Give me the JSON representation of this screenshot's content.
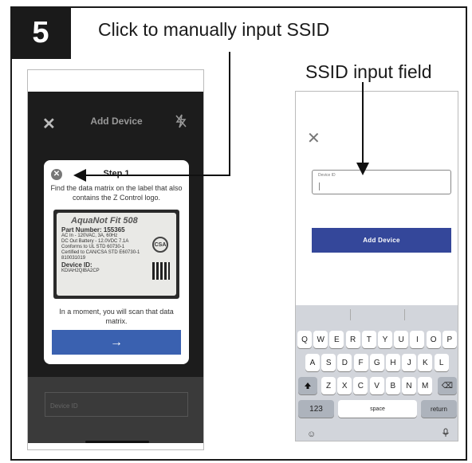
{
  "step_number": "5",
  "captions": {
    "manual_input": "Click to manually input SSID",
    "ssid_field": "SSID input field"
  },
  "left_screen": {
    "header_title": "Add Device",
    "dialog": {
      "title": "Step 1",
      "instruction": "Find the data matrix on the label that also contains the Z Control logo.",
      "label_photo": {
        "brand": "AquaNot Fit 508",
        "part_number": "Part Number: 155365",
        "specs": [
          "AC In - 120VAC, 3A, 60Hz",
          "DC Out Battery - 12.0VDC 7.1A",
          "Conforms to UL STD 60730-1",
          "Certified to CAN/CSA STD E60730-1",
          "810031019"
        ],
        "device_id_label": "Device ID:",
        "device_id_value": "KDIAH2QIBA2CP"
      },
      "note": "In a moment, you will scan that data matrix.",
      "continue_arrow": "→"
    },
    "device_id_placeholder": "Device ID"
  },
  "right_screen": {
    "field_label": "Device ID",
    "add_button": "Add Device",
    "keyboard": {
      "row1": [
        "Q",
        "W",
        "E",
        "R",
        "T",
        "Y",
        "U",
        "I",
        "O",
        "P"
      ],
      "row2": [
        "A",
        "S",
        "D",
        "F",
        "G",
        "H",
        "J",
        "K",
        "L"
      ],
      "row3": [
        "Z",
        "X",
        "C",
        "V",
        "B",
        "N",
        "M"
      ],
      "numbers_key": "123",
      "space_key": "space",
      "return_key": "return"
    }
  },
  "colors": {
    "button_blue": "#3a61b0",
    "add_button_blue": "#34479a",
    "dark_overlay": "#1c1c1c"
  }
}
